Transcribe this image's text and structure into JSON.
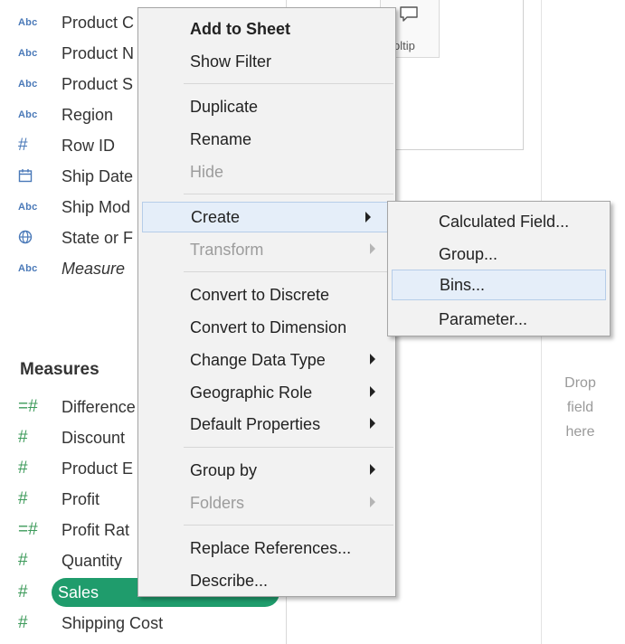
{
  "dimensions": [
    {
      "icon": "Abc",
      "label": "Product C"
    },
    {
      "icon": "Abc",
      "label": "Product N"
    },
    {
      "icon": "Abc",
      "label": "Product S"
    },
    {
      "icon": "Abc",
      "label": "Region"
    },
    {
      "icon": "#",
      "label": "Row ID"
    },
    {
      "icon": "calendar-icon",
      "label": "Ship Date"
    },
    {
      "icon": "Abc",
      "label": "Ship Mod"
    },
    {
      "icon": "globe-icon",
      "label": "State or F"
    },
    {
      "icon": "Abc",
      "label": "Measure"
    }
  ],
  "measures_header": "Measures",
  "measures": [
    {
      "icon": "=#",
      "label": "Difference"
    },
    {
      "icon": "#",
      "label": "Discount"
    },
    {
      "icon": "#",
      "label": "Product E"
    },
    {
      "icon": "#",
      "label": "Profit"
    },
    {
      "icon": "=#",
      "label": "Profit Rat"
    },
    {
      "icon": "#",
      "label": "Quantity"
    },
    {
      "icon": "#",
      "label": "Sales"
    },
    {
      "icon": "#",
      "label": "Shipping Cost"
    }
  ],
  "selected_field": "Sales",
  "marks": {
    "tooltip_label": "oltip"
  },
  "drop_zone": {
    "line1": "Drop",
    "line2": "field",
    "line3": "here"
  },
  "context_menu": {
    "items": [
      {
        "label": "Add to Sheet"
      },
      {
        "label": "Show Filter"
      },
      {
        "label": "Duplicate"
      },
      {
        "label": "Rename"
      },
      {
        "label": "Hide"
      },
      {
        "label": "Create"
      },
      {
        "label": "Transform"
      },
      {
        "label": "Convert to Discrete"
      },
      {
        "label": "Convert to Dimension"
      },
      {
        "label": "Change Data Type"
      },
      {
        "label": "Geographic Role"
      },
      {
        "label": "Default Properties"
      },
      {
        "label": "Group by"
      },
      {
        "label": "Folders"
      },
      {
        "label": "Replace References..."
      },
      {
        "label": "Describe..."
      }
    ]
  },
  "create_submenu": {
    "items": [
      {
        "label": "Calculated Field..."
      },
      {
        "label": "Group..."
      },
      {
        "label": "Bins..."
      },
      {
        "label": "Parameter..."
      }
    ]
  },
  "colors": {
    "sales_pill": "#1f9c6c",
    "menu_highlight": "#e5eef9",
    "menu_background": "#f2f2f2",
    "dimension_icon": "#4a79b8",
    "measure_icon": "#3c9a5a"
  }
}
